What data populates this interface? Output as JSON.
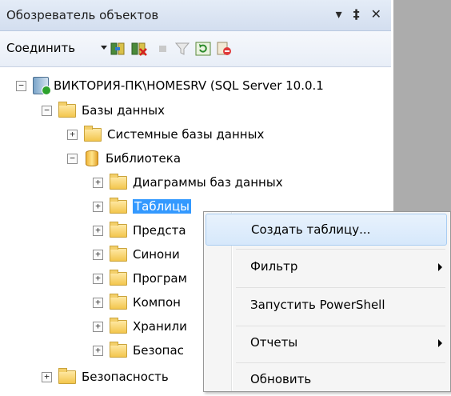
{
  "panel": {
    "title": "Обозреватель объектов",
    "title_icons": [
      "▾",
      "‡",
      "✕"
    ]
  },
  "toolbar": {
    "connect_label": "Соединить",
    "icons": [
      "connect-object-explorer-icon",
      "disconnect-icon",
      "stop-icon",
      "filter-icon",
      "refresh-icon",
      "delete-icon"
    ]
  },
  "tree": {
    "server": "ВИКТОРИЯ-ПК\\HOMESRV (SQL Server 10.0.1",
    "databases": "Базы данных",
    "system_databases": "Системные базы данных",
    "library_db": "Библиотека",
    "children": [
      "Диаграммы баз данных",
      "Таблицы",
      "Предста",
      "Синони",
      "Програм",
      "Компон",
      "Хранили",
      "Безопас"
    ],
    "security": "Безопасность"
  },
  "context_menu": {
    "items": [
      {
        "label": "Создать таблицу...",
        "submenu": false,
        "highlighted": true
      },
      {
        "label": "Фильтр",
        "submenu": true
      },
      {
        "label": "Запустить PowerShell",
        "submenu": false
      },
      {
        "label": "Отчеты",
        "submenu": true
      },
      {
        "label": "Обновить",
        "submenu": false
      }
    ]
  },
  "colors": {
    "selection": "#3399ff",
    "menu_highlight": "#d6e8fb",
    "background_right": "#acacac"
  }
}
